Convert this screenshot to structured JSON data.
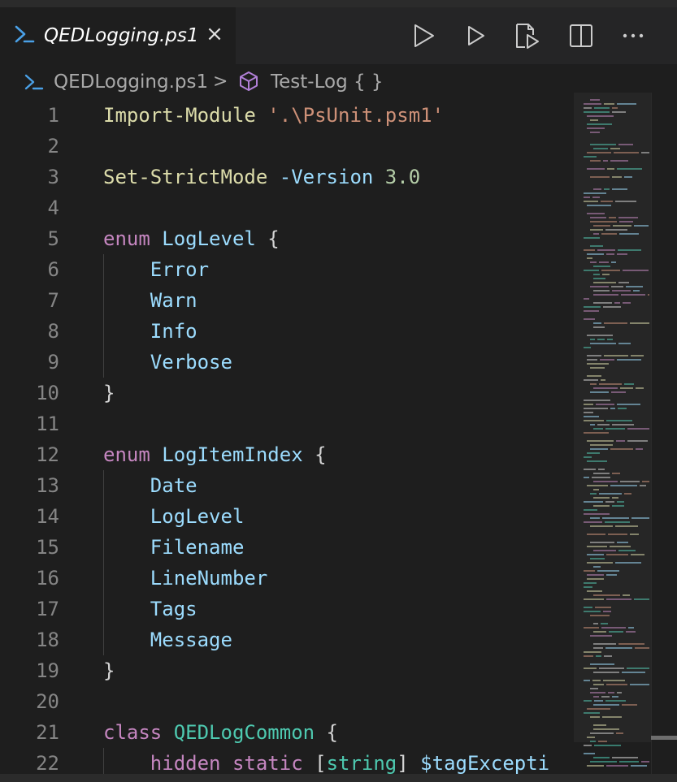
{
  "tab": {
    "filename": "QEDLogging.ps1",
    "close_label": "×",
    "icon": "powershell-icon"
  },
  "actions": [
    "run-icon",
    "run-selection-icon",
    "debug-file-icon",
    "split-editor-icon",
    "more-actions-icon"
  ],
  "breadcrumb": {
    "file": "QEDLogging.ps1",
    "separator": ">",
    "symbol": "Test-Log { }",
    "symbol_icon": "cube-icon"
  },
  "editor": {
    "line_numbers": [
      "1",
      "2",
      "3",
      "4",
      "5",
      "6",
      "7",
      "8",
      "9",
      "10",
      "11",
      "12",
      "13",
      "14",
      "15",
      "16",
      "17",
      "18",
      "19",
      "20",
      "21",
      "22"
    ],
    "lines": [
      [
        {
          "t": "Import-Module",
          "c": "fn"
        },
        {
          "t": " ",
          "c": "plain"
        },
        {
          "t": "'.\\PsUnit.psm1'",
          "c": "str"
        }
      ],
      [],
      [
        {
          "t": "Set-StrictMode",
          "c": "fn"
        },
        {
          "t": " ",
          "c": "plain"
        },
        {
          "t": "-Version",
          "c": "param"
        },
        {
          "t": " ",
          "c": "plain"
        },
        {
          "t": "3.0",
          "c": "num"
        }
      ],
      [],
      [
        {
          "t": "enum",
          "c": "kw"
        },
        {
          "t": " ",
          "c": "plain"
        },
        {
          "t": "LogLevel",
          "c": "member"
        },
        {
          "t": " {",
          "c": "plain"
        }
      ],
      [
        {
          "t": "    ",
          "c": "plain"
        },
        {
          "t": "Error",
          "c": "member"
        }
      ],
      [
        {
          "t": "    ",
          "c": "plain"
        },
        {
          "t": "Warn",
          "c": "member"
        }
      ],
      [
        {
          "t": "    ",
          "c": "plain"
        },
        {
          "t": "Info",
          "c": "member"
        }
      ],
      [
        {
          "t": "    ",
          "c": "plain"
        },
        {
          "t": "Verbose",
          "c": "member"
        }
      ],
      [
        {
          "t": "}",
          "c": "plain"
        }
      ],
      [],
      [
        {
          "t": "enum",
          "c": "kw"
        },
        {
          "t": " ",
          "c": "plain"
        },
        {
          "t": "LogItemIndex",
          "c": "member"
        },
        {
          "t": " {",
          "c": "plain"
        }
      ],
      [
        {
          "t": "    ",
          "c": "plain"
        },
        {
          "t": "Date",
          "c": "member"
        }
      ],
      [
        {
          "t": "    ",
          "c": "plain"
        },
        {
          "t": "LogLevel",
          "c": "member"
        }
      ],
      [
        {
          "t": "    ",
          "c": "plain"
        },
        {
          "t": "Filename",
          "c": "member"
        }
      ],
      [
        {
          "t": "    ",
          "c": "plain"
        },
        {
          "t": "LineNumber",
          "c": "member"
        }
      ],
      [
        {
          "t": "    ",
          "c": "plain"
        },
        {
          "t": "Tags",
          "c": "member"
        }
      ],
      [
        {
          "t": "    ",
          "c": "plain"
        },
        {
          "t": "Message",
          "c": "member"
        }
      ],
      [
        {
          "t": "}",
          "c": "plain"
        }
      ],
      [],
      [
        {
          "t": "class",
          "c": "kw"
        },
        {
          "t": " ",
          "c": "plain"
        },
        {
          "t": "QEDLogCommon",
          "c": "type"
        },
        {
          "t": " {",
          "c": "plain"
        }
      ],
      [
        {
          "t": "    ",
          "c": "plain"
        },
        {
          "t": "hidden",
          "c": "kw"
        },
        {
          "t": " ",
          "c": "plain"
        },
        {
          "t": "static",
          "c": "kw"
        },
        {
          "t": " [",
          "c": "plain"
        },
        {
          "t": "string",
          "c": "type"
        },
        {
          "t": "] ",
          "c": "plain"
        },
        {
          "t": "$tagExcepti",
          "c": "var"
        }
      ]
    ]
  },
  "colors": {
    "keyword": "#c586c0",
    "function": "#dcdcaa",
    "string": "#ce9178",
    "parameter": "#9cdcfe",
    "number": "#b5cea8",
    "type": "#4ec9b0",
    "plain": "#d4d4d4",
    "line_number": "#858585",
    "background": "#1e1e1e"
  }
}
